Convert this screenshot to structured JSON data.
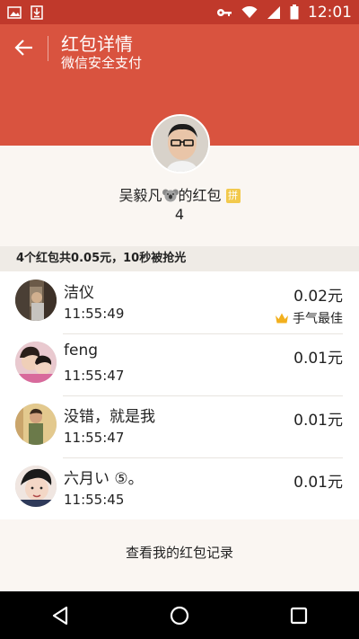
{
  "status_bar": {
    "time": "12:01",
    "icons": [
      "image-icon",
      "download-icon",
      "key-icon",
      "wifi-icon",
      "signal-icon",
      "battery-icon"
    ]
  },
  "header": {
    "title": "红包详情",
    "subtitle": "微信安全支付",
    "back_icon": "arrow-left-icon"
  },
  "sender": {
    "name_prefix": "吴毅凡",
    "name_suffix": "的红包",
    "badge": "拼",
    "count": "4"
  },
  "summary": "4个红包共0.05元，10秒被抢光",
  "receivers": [
    {
      "name": "洁仪",
      "time": "11:55:49",
      "amount": "0.02元",
      "best_label": "手气最佳"
    },
    {
      "name": "feng",
      "time": "11:55:47",
      "amount": "0.01元"
    },
    {
      "name": "没错，就是我",
      "time": "11:55:47",
      "amount": "0.01元"
    },
    {
      "name": "六月い ⑤。",
      "time": "11:55:45",
      "amount": "0.01元"
    }
  ],
  "footer_link": "查看我的红包记录",
  "colors": {
    "header_red": "#d9533f",
    "status_red": "#c0392b",
    "crown": "#f2b01e"
  }
}
